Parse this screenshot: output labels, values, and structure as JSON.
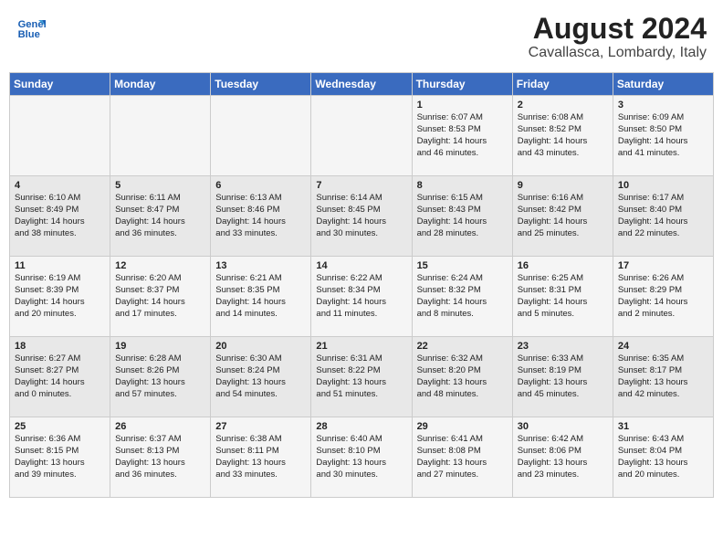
{
  "header": {
    "logo_line1": "General",
    "logo_line2": "Blue",
    "month": "August 2024",
    "location": "Cavallasca, Lombardy, Italy"
  },
  "weekdays": [
    "Sunday",
    "Monday",
    "Tuesday",
    "Wednesday",
    "Thursday",
    "Friday",
    "Saturday"
  ],
  "weeks": [
    [
      {
        "day": "",
        "info": ""
      },
      {
        "day": "",
        "info": ""
      },
      {
        "day": "",
        "info": ""
      },
      {
        "day": "",
        "info": ""
      },
      {
        "day": "1",
        "info": "Sunrise: 6:07 AM\nSunset: 8:53 PM\nDaylight: 14 hours\nand 46 minutes."
      },
      {
        "day": "2",
        "info": "Sunrise: 6:08 AM\nSunset: 8:52 PM\nDaylight: 14 hours\nand 43 minutes."
      },
      {
        "day": "3",
        "info": "Sunrise: 6:09 AM\nSunset: 8:50 PM\nDaylight: 14 hours\nand 41 minutes."
      }
    ],
    [
      {
        "day": "4",
        "info": "Sunrise: 6:10 AM\nSunset: 8:49 PM\nDaylight: 14 hours\nand 38 minutes."
      },
      {
        "day": "5",
        "info": "Sunrise: 6:11 AM\nSunset: 8:47 PM\nDaylight: 14 hours\nand 36 minutes."
      },
      {
        "day": "6",
        "info": "Sunrise: 6:13 AM\nSunset: 8:46 PM\nDaylight: 14 hours\nand 33 minutes."
      },
      {
        "day": "7",
        "info": "Sunrise: 6:14 AM\nSunset: 8:45 PM\nDaylight: 14 hours\nand 30 minutes."
      },
      {
        "day": "8",
        "info": "Sunrise: 6:15 AM\nSunset: 8:43 PM\nDaylight: 14 hours\nand 28 minutes."
      },
      {
        "day": "9",
        "info": "Sunrise: 6:16 AM\nSunset: 8:42 PM\nDaylight: 14 hours\nand 25 minutes."
      },
      {
        "day": "10",
        "info": "Sunrise: 6:17 AM\nSunset: 8:40 PM\nDaylight: 14 hours\nand 22 minutes."
      }
    ],
    [
      {
        "day": "11",
        "info": "Sunrise: 6:19 AM\nSunset: 8:39 PM\nDaylight: 14 hours\nand 20 minutes."
      },
      {
        "day": "12",
        "info": "Sunrise: 6:20 AM\nSunset: 8:37 PM\nDaylight: 14 hours\nand 17 minutes."
      },
      {
        "day": "13",
        "info": "Sunrise: 6:21 AM\nSunset: 8:35 PM\nDaylight: 14 hours\nand 14 minutes."
      },
      {
        "day": "14",
        "info": "Sunrise: 6:22 AM\nSunset: 8:34 PM\nDaylight: 14 hours\nand 11 minutes."
      },
      {
        "day": "15",
        "info": "Sunrise: 6:24 AM\nSunset: 8:32 PM\nDaylight: 14 hours\nand 8 minutes."
      },
      {
        "day": "16",
        "info": "Sunrise: 6:25 AM\nSunset: 8:31 PM\nDaylight: 14 hours\nand 5 minutes."
      },
      {
        "day": "17",
        "info": "Sunrise: 6:26 AM\nSunset: 8:29 PM\nDaylight: 14 hours\nand 2 minutes."
      }
    ],
    [
      {
        "day": "18",
        "info": "Sunrise: 6:27 AM\nSunset: 8:27 PM\nDaylight: 14 hours\nand 0 minutes."
      },
      {
        "day": "19",
        "info": "Sunrise: 6:28 AM\nSunset: 8:26 PM\nDaylight: 13 hours\nand 57 minutes."
      },
      {
        "day": "20",
        "info": "Sunrise: 6:30 AM\nSunset: 8:24 PM\nDaylight: 13 hours\nand 54 minutes."
      },
      {
        "day": "21",
        "info": "Sunrise: 6:31 AM\nSunset: 8:22 PM\nDaylight: 13 hours\nand 51 minutes."
      },
      {
        "day": "22",
        "info": "Sunrise: 6:32 AM\nSunset: 8:20 PM\nDaylight: 13 hours\nand 48 minutes."
      },
      {
        "day": "23",
        "info": "Sunrise: 6:33 AM\nSunset: 8:19 PM\nDaylight: 13 hours\nand 45 minutes."
      },
      {
        "day": "24",
        "info": "Sunrise: 6:35 AM\nSunset: 8:17 PM\nDaylight: 13 hours\nand 42 minutes."
      }
    ],
    [
      {
        "day": "25",
        "info": "Sunrise: 6:36 AM\nSunset: 8:15 PM\nDaylight: 13 hours\nand 39 minutes."
      },
      {
        "day": "26",
        "info": "Sunrise: 6:37 AM\nSunset: 8:13 PM\nDaylight: 13 hours\nand 36 minutes."
      },
      {
        "day": "27",
        "info": "Sunrise: 6:38 AM\nSunset: 8:11 PM\nDaylight: 13 hours\nand 33 minutes."
      },
      {
        "day": "28",
        "info": "Sunrise: 6:40 AM\nSunset: 8:10 PM\nDaylight: 13 hours\nand 30 minutes."
      },
      {
        "day": "29",
        "info": "Sunrise: 6:41 AM\nSunset: 8:08 PM\nDaylight: 13 hours\nand 27 minutes."
      },
      {
        "day": "30",
        "info": "Sunrise: 6:42 AM\nSunset: 8:06 PM\nDaylight: 13 hours\nand 23 minutes."
      },
      {
        "day": "31",
        "info": "Sunrise: 6:43 AM\nSunset: 8:04 PM\nDaylight: 13 hours\nand 20 minutes."
      }
    ]
  ]
}
